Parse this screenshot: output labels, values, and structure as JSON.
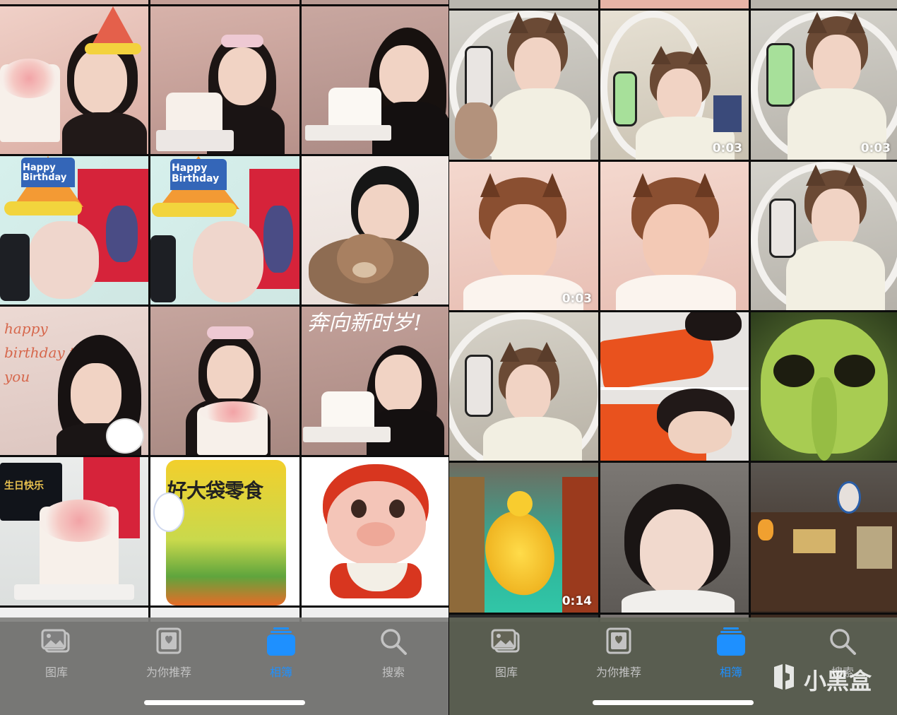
{
  "left_panel": {
    "cells": [
      {
        "id": "l-r0c0"
      },
      {
        "id": "l-r0c1"
      },
      {
        "id": "l-r0c2"
      },
      {
        "id": "l-r1c0",
        "thumb_text": "Happy Birthday"
      },
      {
        "id": "l-r1c1",
        "thumb_text": "Happy Birthday"
      },
      {
        "id": "l-r1c2"
      },
      {
        "id": "l-r2c0",
        "thumb_text": "happy birthday to you"
      },
      {
        "id": "l-r2c1"
      },
      {
        "id": "l-r2c2",
        "thumb_text": "奔向新时岁!"
      },
      {
        "id": "l-r3c0",
        "thumb_text": "生日快乐"
      },
      {
        "id": "l-r3c1",
        "thumb_text": "好大袋零食"
      },
      {
        "id": "l-r3c2"
      }
    ],
    "tabbar": {
      "tabs": [
        {
          "label": "图库",
          "icon": "photo-library-icon",
          "active": false
        },
        {
          "label": "为你推荐",
          "icon": "for-you-icon",
          "active": false
        },
        {
          "label": "相簿",
          "icon": "albums-icon",
          "active": true
        },
        {
          "label": "搜索",
          "icon": "search-icon",
          "active": false
        }
      ]
    }
  },
  "right_panel": {
    "cells": [
      {
        "id": "r-r0c0",
        "duration": ""
      },
      {
        "id": "r-r0c1",
        "duration": "0:03"
      },
      {
        "id": "r-r0c2",
        "duration": "0:03"
      },
      {
        "id": "r-r1c0",
        "duration": "0:03"
      },
      {
        "id": "r-r1c1",
        "duration": ""
      },
      {
        "id": "r-r1c2",
        "duration": ""
      },
      {
        "id": "r-r2c0",
        "duration": ""
      },
      {
        "id": "r-r2c1",
        "duration": ""
      },
      {
        "id": "r-r2c2",
        "duration": ""
      },
      {
        "id": "r-r3c0",
        "duration": "0:14"
      },
      {
        "id": "r-r3c1",
        "duration": ""
      },
      {
        "id": "r-r3c2",
        "duration": ""
      }
    ],
    "tabbar": {
      "tabs": [
        {
          "label": "图库",
          "icon": "photo-library-icon",
          "active": false
        },
        {
          "label": "为你推荐",
          "icon": "for-you-icon",
          "active": false
        },
        {
          "label": "相簿",
          "icon": "albums-icon",
          "active": true
        },
        {
          "label": "搜索",
          "icon": "search-icon",
          "active": false
        }
      ]
    },
    "watermark": {
      "text": "小黑盒",
      "icon": "xiaoheihe-logo-icon"
    }
  },
  "colors": {
    "accent": "#1e90ff",
    "tab_inactive": "#c3c3c3",
    "tabbar_bg": "#80807e"
  }
}
